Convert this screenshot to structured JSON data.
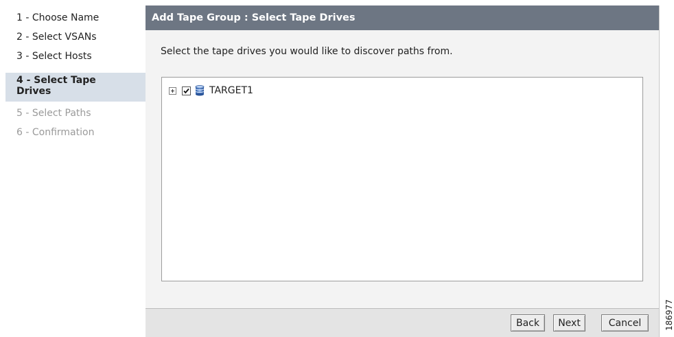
{
  "wizard": {
    "steps": [
      {
        "label": "1 - Choose Name",
        "state": "done"
      },
      {
        "label": "2 - Select VSANs",
        "state": "done"
      },
      {
        "label": "3 - Select Hosts",
        "state": "done"
      },
      {
        "label_line1": "4 - Select Tape",
        "label_line2": "Drives",
        "state": "current"
      },
      {
        "label": "5 - Select Paths",
        "state": "future"
      },
      {
        "label": "6 - Confirmation",
        "state": "future"
      }
    ]
  },
  "panel": {
    "title": "Add Tape Group : Select Tape Drives",
    "instruction": "Select the tape drives you would like to discover paths from."
  },
  "tree": {
    "items": [
      {
        "label": "TARGET1",
        "checked": true,
        "expanded": false,
        "icon": "database-icon"
      }
    ]
  },
  "buttons": {
    "back": "Back",
    "next": "Next",
    "cancel": "Cancel"
  },
  "figure_number": "186977",
  "colors": {
    "header_bg": "#6d7683",
    "current_step_bg": "#d7dfe8",
    "panel_bg": "#f3f3f3",
    "footer_bg": "#e4e4e4",
    "disabled_text": "#9a9a9a"
  }
}
